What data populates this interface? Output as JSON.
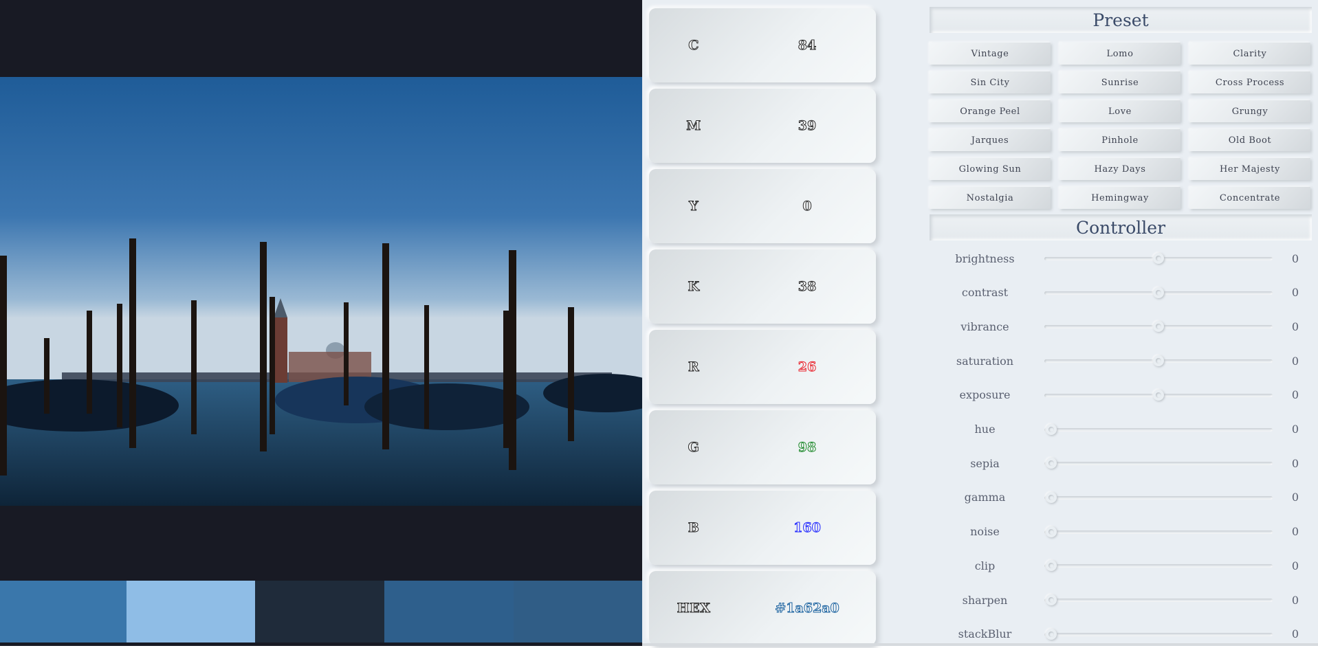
{
  "image": {
    "description_icon": "photo-venice-gondolas"
  },
  "palette": {
    "swatches": [
      {
        "color": "#3a77ab"
      },
      {
        "color": "#8fbde6"
      },
      {
        "color": "#1f2b3a"
      },
      {
        "color": "#2e5f8c"
      },
      {
        "color": "#305d86"
      }
    ]
  },
  "values": [
    {
      "label": "C",
      "value": "84",
      "tone": "plain"
    },
    {
      "label": "M",
      "value": "39",
      "tone": "plain"
    },
    {
      "label": "Y",
      "value": "0",
      "tone": "plain"
    },
    {
      "label": "K",
      "value": "38",
      "tone": "plain"
    },
    {
      "label": "R",
      "value": "26",
      "tone": "red"
    },
    {
      "label": "G",
      "value": "98",
      "tone": "green"
    },
    {
      "label": "B",
      "value": "160",
      "tone": "blue"
    },
    {
      "label": "HEX",
      "value": "#1a62a0",
      "tone": "hex"
    }
  ],
  "preset": {
    "title": "Preset",
    "buttons": [
      "Vintage",
      "Lomo",
      "Clarity",
      "Sin City",
      "Sunrise",
      "Cross Process",
      "Orange Peel",
      "Love",
      "Grungy",
      "Jarques",
      "Pinhole",
      "Old Boot",
      "Glowing Sun",
      "Hazy Days",
      "Her Majesty",
      "Nostalgia",
      "Hemingway",
      "Concentrate"
    ]
  },
  "controller": {
    "title": "Controller",
    "sliders": [
      {
        "name": "brightness",
        "value": "0",
        "position": 0.5
      },
      {
        "name": "contrast",
        "value": "0",
        "position": 0.5
      },
      {
        "name": "vibrance",
        "value": "0",
        "position": 0.5
      },
      {
        "name": "saturation",
        "value": "0",
        "position": 0.5
      },
      {
        "name": "exposure",
        "value": "0",
        "position": 0.5
      },
      {
        "name": "hue",
        "value": "0",
        "position": 0
      },
      {
        "name": "sepia",
        "value": "0",
        "position": 0
      },
      {
        "name": "gamma",
        "value": "0",
        "position": 0
      },
      {
        "name": "noise",
        "value": "0",
        "position": 0
      },
      {
        "name": "clip",
        "value": "0",
        "position": 0
      },
      {
        "name": "sharpen",
        "value": "0",
        "position": 0
      },
      {
        "name": "stackBlur",
        "value": "0",
        "position": 0
      }
    ]
  }
}
